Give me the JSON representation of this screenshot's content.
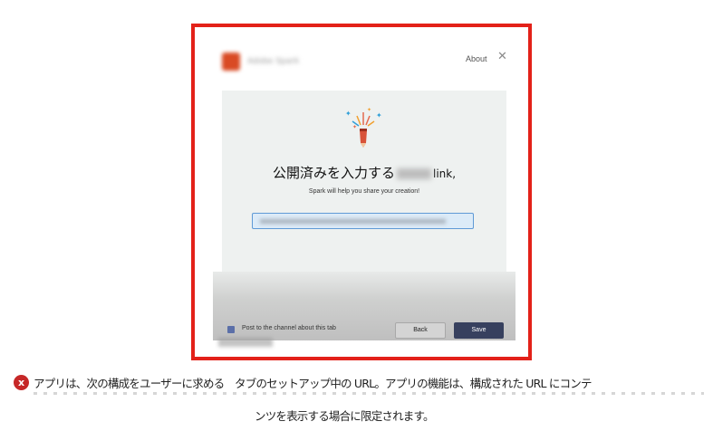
{
  "dialog": {
    "about_label": "About",
    "close_glyph": "✕",
    "close_icon": "close-icon",
    "app_icon": "spark-logo-icon",
    "illustration_icon": "confetti-pencil-icon"
  },
  "content": {
    "headline_prefix": "公開済みを入力する",
    "headline_suffix": "link,",
    "subtext": "Spark will help you share your creation!"
  },
  "footer": {
    "checkbox_label": "Post to the channel about this tab",
    "checkbox_checked": true,
    "back_label": "Back",
    "save_label": "Save"
  },
  "caption": {
    "error_glyph": "x",
    "line1": "アプリは、次の構成をユーザーに求める　タブのセットアップ中の URL。アプリの機能は、構成された URL にコンテ",
    "line2": "ンツを表示する場合に限定されます。"
  },
  "colors": {
    "frame_border": "#e32119",
    "save_button": "#37405e",
    "input_border": "#5f9ad6",
    "error_icon": "#c62828"
  }
}
